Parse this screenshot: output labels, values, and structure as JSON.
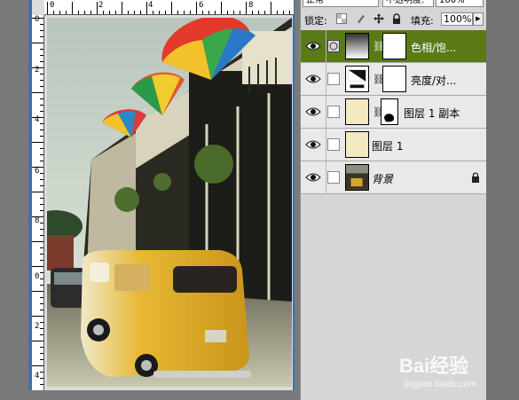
{
  "ruler": {
    "h_labels": [
      "0",
      "2",
      "4",
      "6",
      "8"
    ],
    "v_labels": [
      "0",
      "2",
      "4",
      "6",
      "8",
      "0",
      "2",
      "4"
    ]
  },
  "options": {
    "blend_mode": "正常",
    "opacity_label": "不透明度:",
    "opacity_value": "100%"
  },
  "lock": {
    "label": "锁定:",
    "fill_label": "填充:",
    "fill_value": "100%"
  },
  "layers": [
    {
      "name": "色相/饱...",
      "selected": true
    },
    {
      "name": "亮度/对...",
      "selected": false
    },
    {
      "name": "图层 1 副本",
      "selected": false
    },
    {
      "name": "图层 1",
      "selected": false
    },
    {
      "name": "背景",
      "selected": false,
      "locked": true
    }
  ],
  "watermark": {
    "logo_text": "Bai经验",
    "url": "jingyan.baidu.com"
  },
  "colors": {
    "selected_layer": "#5a7a17",
    "doc_border": "#3d6fb6",
    "van_yellow": "#e8b835"
  }
}
